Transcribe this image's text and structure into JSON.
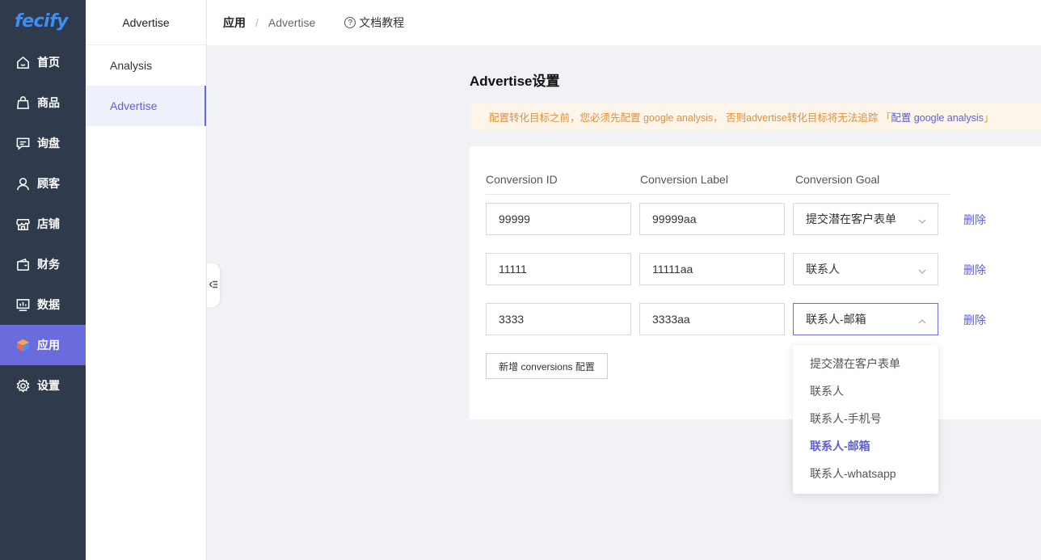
{
  "app": {
    "logo": "fecify"
  },
  "sidebar": {
    "items": [
      {
        "label": "首页",
        "icon": "home-icon"
      },
      {
        "label": "商品",
        "icon": "bag-icon"
      },
      {
        "label": "询盘",
        "icon": "message-icon"
      },
      {
        "label": "顾客",
        "icon": "user-icon"
      },
      {
        "label": "店铺",
        "icon": "store-icon"
      },
      {
        "label": "财务",
        "icon": "wallet-icon"
      },
      {
        "label": "数据",
        "icon": "chart-icon"
      },
      {
        "label": "应用",
        "icon": "cube-icon",
        "active": true
      },
      {
        "label": "设置",
        "icon": "gear-icon"
      }
    ],
    "active_color": "#6a6bdc"
  },
  "subsidebar": {
    "title": "Advertise",
    "items": [
      {
        "label": "Analysis"
      },
      {
        "label": "Advertise",
        "active": true
      }
    ]
  },
  "breadcrumb": {
    "root": "应用",
    "separator": "/",
    "current": "Advertise",
    "doc_link": "文档教程"
  },
  "main": {
    "title": "Advertise设置",
    "notice": {
      "text": "配置转化目标之前，您必须先配置 google analysis， 否则advertise转化目标将无法追踪 「",
      "link": "配置 google analysis",
      "suffix": "」"
    },
    "columns": [
      "Conversion ID",
      "Conversion Label",
      "Conversion Goal"
    ],
    "rows": [
      {
        "id": "99999",
        "label": "99999aa",
        "goal": "提交潜在客户表单",
        "delete": "删除"
      },
      {
        "id": "11111",
        "label": "11111aa",
        "goal": "联系人",
        "delete": "删除"
      },
      {
        "id": "3333",
        "label": "3333aa",
        "goal": "联系人-邮箱",
        "delete": "删除",
        "open": true
      }
    ],
    "add_button": "新增 conversions 配置",
    "dropdown_options": [
      "提交潜在客户表单",
      "联系人",
      "联系人-手机号",
      "联系人-邮箱",
      "联系人-whatsapp"
    ],
    "dropdown_selected": "联系人-邮箱"
  }
}
